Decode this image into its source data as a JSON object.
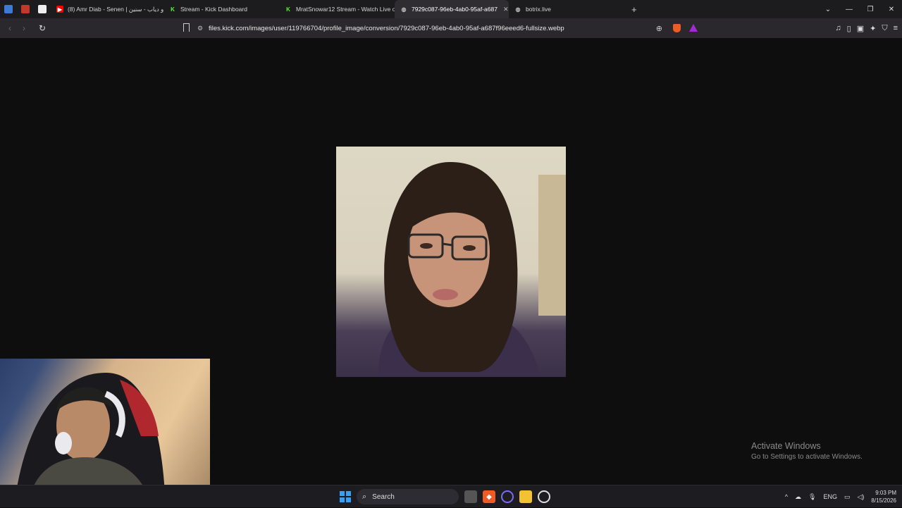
{
  "browser": {
    "tabs": [
      {
        "label": "(8) Amr Diab - Senen | عمرو دياب - سنين",
        "favicon": "youtube-icon",
        "color": "#ff0000"
      },
      {
        "label": "Stream - Kick Dashboard",
        "favicon": "kick-icon",
        "color": "#53fc18"
      },
      {
        "label": "MratSnowar12 Stream - Watch Live o",
        "favicon": "kick-icon",
        "color": "#53fc18"
      },
      {
        "label": "7929c087-96eb-4ab0-95af-a687",
        "favicon": "globe-icon",
        "color": "#bbbbbb",
        "active": true
      },
      {
        "label": "botrix.live",
        "favicon": "globe-icon",
        "color": "#bbbbbb"
      }
    ],
    "url": "files.kick.com/images/user/119766704/profile_image/conversion/7929c087-96eb-4ab0-95af-a687f96eeed6-fullsize.webp"
  },
  "watermark": {
    "title": "Activate Windows",
    "subtitle": "Go to Settings to activate Windows."
  },
  "taskbar": {
    "search_label": "Search",
    "language": "ENG",
    "time": "9:03 PM",
    "date": "8/15/2026"
  }
}
